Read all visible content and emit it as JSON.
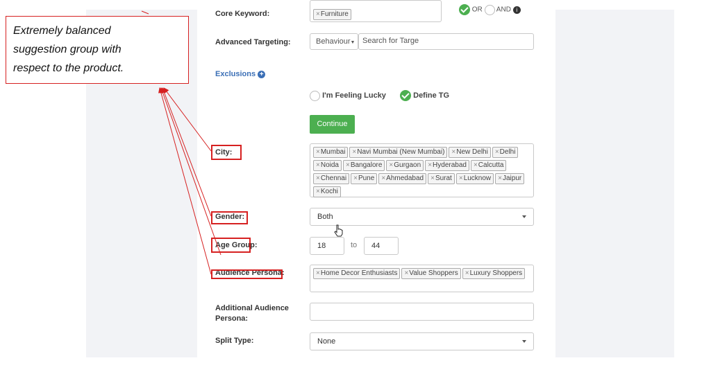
{
  "callout": {
    "lines": [
      "Extremely balanced",
      "suggestion group with",
      "respect to the product."
    ]
  },
  "core_keyword": {
    "label": "Core Keyword:",
    "tags": [
      "Furniture"
    ],
    "or_label": "OR",
    "and_label": "AND"
  },
  "advanced_targeting": {
    "label": "Advanced Targeting:",
    "select_value": "Behaviour",
    "search_placeholder": "Search for Targe"
  },
  "exclusions": {
    "label": "Exclusions"
  },
  "tg_mode": {
    "option1": "I'm Feeling Lucky",
    "option2": "Define TG"
  },
  "continue_label": "Continue",
  "city": {
    "label": "City:",
    "tags": [
      "Mumbai",
      "Navi Mumbai (New Mumbai)",
      "New Delhi",
      "Delhi",
      "Noida",
      "Bangalore",
      "Gurgaon",
      "Hyderabad",
      "Calcutta",
      "Chennai",
      "Pune",
      "Ahmedabad",
      "Surat",
      "Lucknow",
      "Jaipur",
      "Kochi"
    ]
  },
  "gender": {
    "label": "Gender:",
    "value": "Both"
  },
  "age_group": {
    "label": "Age Group:",
    "from": "18",
    "to_label": "to",
    "to": "44"
  },
  "audience_persona": {
    "label": "Audience Persona:",
    "tags": [
      "Home Decor Enthusiasts",
      "Value Shoppers",
      "Luxury Shoppers"
    ]
  },
  "additional_persona": {
    "label_line1": "Additional Audience",
    "label_line2": "Persona:"
  },
  "split_type": {
    "label": "Split Type:",
    "value": "None"
  },
  "colors": {
    "accent_green": "#4caf50",
    "annotation_red": "#d62020",
    "link_blue": "#3b6fb6"
  }
}
